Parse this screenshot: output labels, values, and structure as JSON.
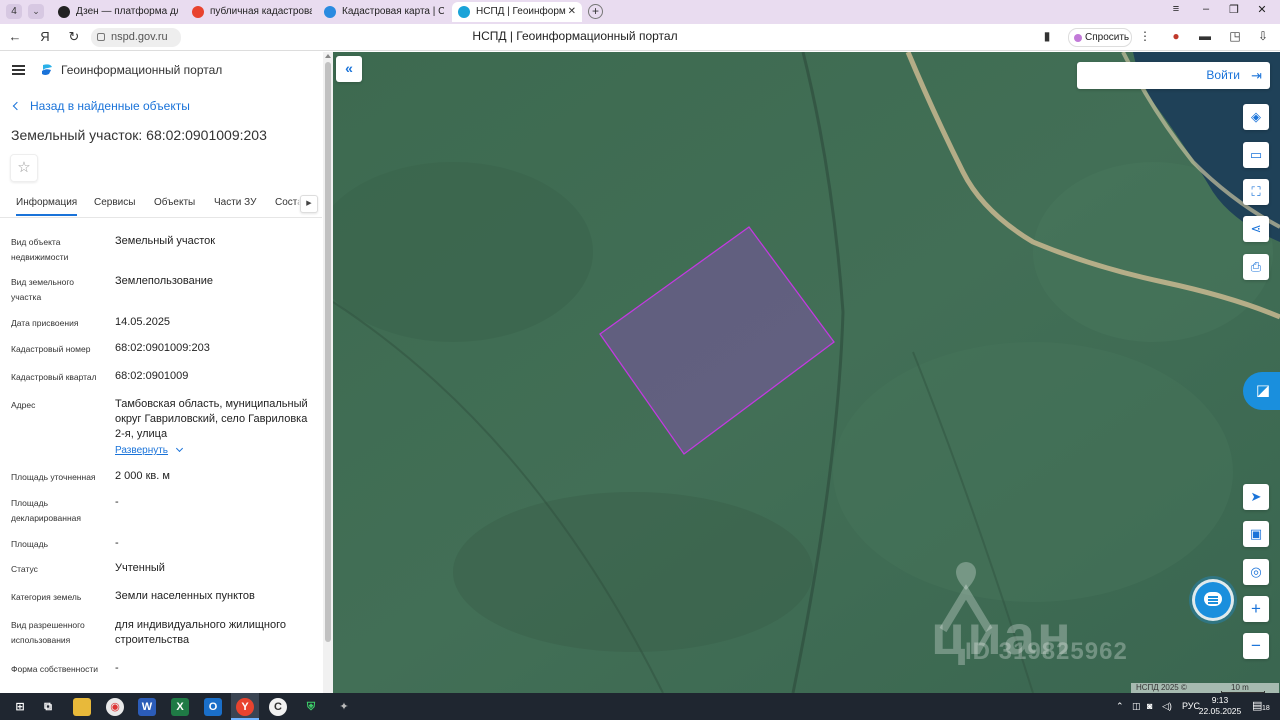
{
  "browser": {
    "tab_count": "4",
    "tabs": [
      {
        "title": "Дзен — платформа для п",
        "color": "#222222"
      },
      {
        "title": "публичная кадастровая к",
        "color": "#e8432e"
      },
      {
        "title": "Кадастровая карта | Серв",
        "color": "#2a8be0"
      },
      {
        "title": "НСПД | Геоинформацио",
        "color": "#1aa3d8"
      }
    ],
    "address": "nspd.gov.ru",
    "page_title": "НСПД | Геоинформационный портал",
    "ask_button": "Спросить"
  },
  "panel": {
    "portal_name": "Геоинформационный портал",
    "back_link": "Назад в найденные объекты",
    "object_title": "Земельный участок: 68:02:0901009:203",
    "tabs": [
      "Информация",
      "Сервисы",
      "Объекты",
      "Части ЗУ",
      "Соста"
    ],
    "expand_link": "Развернуть",
    "fields": [
      {
        "label": "Вид объекта недвижимости",
        "value": "Земельный участок"
      },
      {
        "label": "Вид земельного участка",
        "value": "Землепользование"
      },
      {
        "label": "Дата присвоения",
        "value": "14.05.2025"
      },
      {
        "label": "Кадастровый номер",
        "value": "68:02:0901009:203"
      },
      {
        "label": "Кадастровый квартал",
        "value": "68:02:0901009"
      },
      {
        "label": "Адрес",
        "value": "Тамбовская область, муниципальный округ Гавриловский, село Гавриловка 2-я, улица"
      },
      {
        "label": "Площадь уточненная",
        "value": "2 000 кв. м"
      },
      {
        "label": "Площадь декларированная",
        "value": "-"
      },
      {
        "label": "Площадь",
        "value": "-"
      },
      {
        "label": "Статус",
        "value": "Учтенный"
      },
      {
        "label": "Категория земель",
        "value": "Земли населенных пунктов"
      },
      {
        "label": "Вид разрешенного использования",
        "value": "для индивидуального жилищного строительства"
      },
      {
        "label": "Форма собственности",
        "value": "-"
      }
    ]
  },
  "map": {
    "login_label": "Войти",
    "watermark_brand": "циан",
    "watermark_id": "ID 319825962",
    "attribution": "НСПД 2025 ©",
    "scale_label": "10 m",
    "parcel_color": "#b23ad6",
    "tool_icons": [
      "layers-icon",
      "ruler-icon",
      "area-select-icon",
      "share-icon",
      "print-icon"
    ],
    "nav_icons": [
      "locate-icon",
      "minimap-icon",
      "geolocation-icon"
    ],
    "zoom_in": "+",
    "zoom_out": "−"
  },
  "taskbar": {
    "language": "РУС",
    "time": "9:13",
    "date": "22.05.2025",
    "notifications": "18"
  }
}
